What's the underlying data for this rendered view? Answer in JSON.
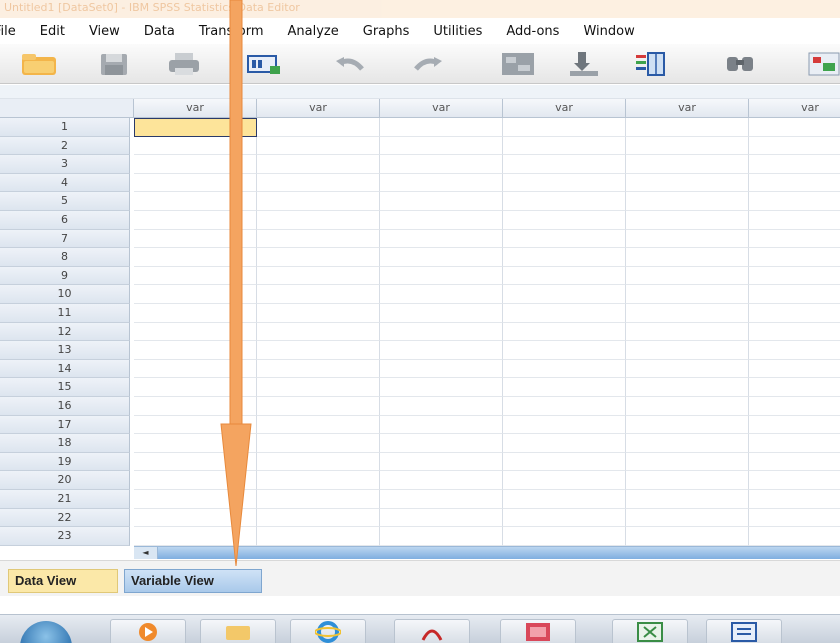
{
  "window": {
    "title": "Untitled1 [DataSet0] - IBM SPSS Statistics Data Editor"
  },
  "menu": [
    "File",
    "Edit",
    "View",
    "Data",
    "Transform",
    "Analyze",
    "Graphs",
    "Utilities",
    "Add-ons",
    "Window"
  ],
  "toolbar": {
    "icons": [
      "open-folder-icon",
      "save-icon",
      "print-icon",
      "recall-dialog-icon",
      "undo-icon",
      "redo-icon",
      "goto-case-icon",
      "goto-variable-icon",
      "variables-icon",
      "find-icon",
      "insert-cases-icon"
    ]
  },
  "grid": {
    "columns": [
      "var",
      "var",
      "var",
      "var",
      "var",
      "var"
    ],
    "rows": [
      "1",
      "2",
      "3",
      "4",
      "5",
      "6",
      "7",
      "8",
      "9",
      "10",
      "11",
      "12",
      "13",
      "14",
      "15",
      "16",
      "17",
      "18",
      "19",
      "20",
      "21",
      "22",
      "23"
    ]
  },
  "scroll": {
    "left_arrow": "◄"
  },
  "tabs": {
    "data_view": "Data View",
    "variable_view": "Variable View"
  },
  "taskbar": {
    "apps": [
      "start-orb-icon",
      "media-player-icon",
      "explorer-icon",
      "ie-icon",
      "acrobat-icon",
      "spss-icon",
      "excel-icon",
      "word-icon"
    ]
  },
  "annotation": {
    "arrow_color": "#f4a460"
  }
}
